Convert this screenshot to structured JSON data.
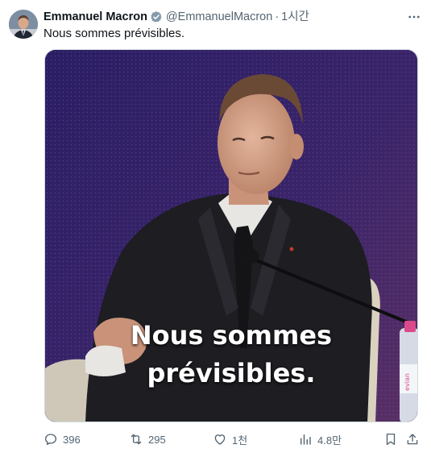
{
  "author": {
    "display_name": "Emmanuel Macron",
    "handle": "@EmmanuelMacron",
    "separator": "·",
    "time_ago": "1시간",
    "verified_color": "#829aab"
  },
  "tweet": {
    "text": "Nous sommes prévisibles."
  },
  "media": {
    "caption_line1": "Nous sommes",
    "caption_line2": "prévisibles.",
    "bottle_label": "evian"
  },
  "actions": {
    "replies": "396",
    "reposts": "295",
    "likes": "1천",
    "views": "4.8만"
  },
  "colors": {
    "text_primary": "#0f1419",
    "text_secondary": "#536471",
    "media_background": "#3a2463"
  },
  "icons": [
    "more-icon",
    "verified-badge-icon",
    "reply-icon",
    "repost-icon",
    "like-icon",
    "views-icon",
    "bookmark-icon",
    "share-icon"
  ]
}
